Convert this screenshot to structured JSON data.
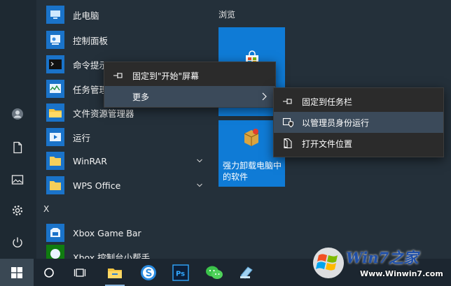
{
  "apps": [
    {
      "label": "此电脑",
      "icon": "computer-icon"
    },
    {
      "label": "控制面板",
      "icon": "control-panel-icon"
    },
    {
      "label": "命令提示",
      "icon": "cmd-icon"
    },
    {
      "label": "任务管理",
      "icon": "task-manager-icon"
    },
    {
      "label": "文件资源管理器",
      "icon": "file-explorer-icon"
    },
    {
      "label": "运行",
      "icon": "run-icon"
    },
    {
      "label": "WinRAR",
      "icon": "folder-icon"
    },
    {
      "label": "WPS Office",
      "icon": "folder-icon"
    },
    {
      "label": "Xbox Game Bar",
      "icon": "xbox-icon"
    },
    {
      "label": "Xbox 控制台小帮手",
      "icon": "xbox-companion-icon"
    }
  ],
  "group_letter": "X",
  "tiles": {
    "header": "浏览",
    "uninstall_tile_label": "强力卸载电脑中的软件"
  },
  "context_menu": {
    "pin_start": "固定到\"开始\"屏幕",
    "more": "更多"
  },
  "submenu": {
    "pin_taskbar": "固定到任务栏",
    "run_as_admin": "以管理员身份运行",
    "open_location": "打开文件位置"
  },
  "watermark": {
    "brand": "Win7之家",
    "url": "Www.Winwin7.com"
  },
  "colors": {
    "tile_blue": "#0f7bd6",
    "accent": "#89b4db"
  }
}
